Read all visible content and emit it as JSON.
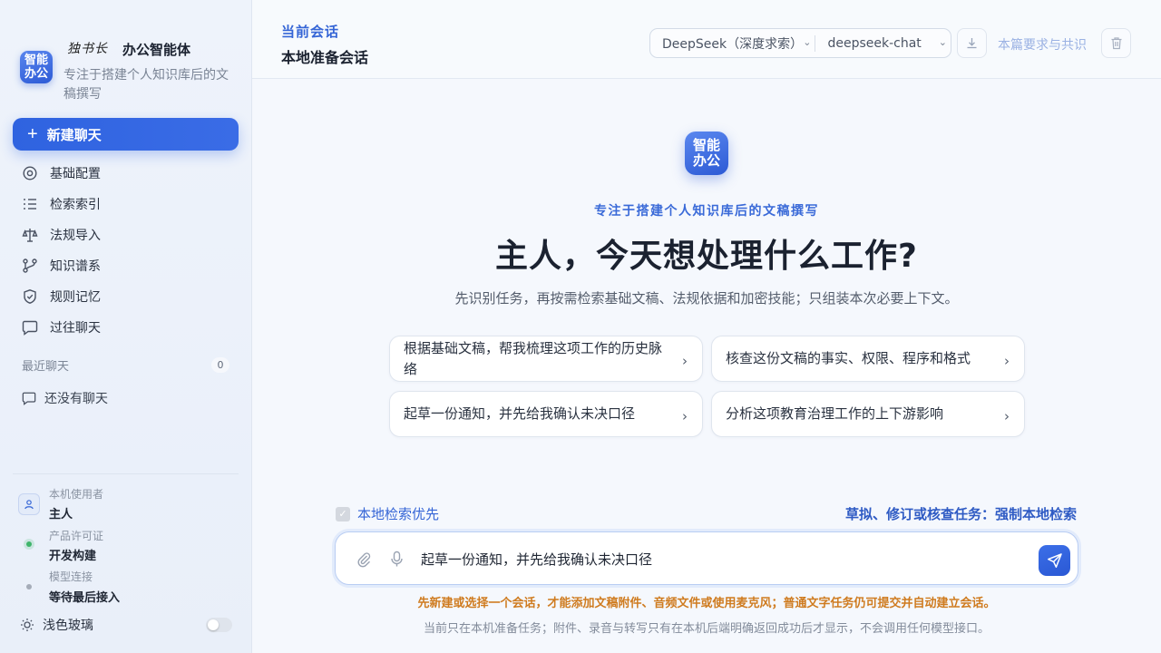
{
  "brand": {
    "logo_text": "智能\n办公",
    "signature": "独书长",
    "name": "办公智能体",
    "description": "专注于搭建个人知识库后的文稿撰写"
  },
  "sidebar": {
    "new_chat_label": "新建聊天",
    "nav": [
      {
        "label": "基础配置",
        "icon": "gear-icon"
      },
      {
        "label": "检索索引",
        "icon": "list-icon"
      },
      {
        "label": "法规导入",
        "icon": "scale-icon"
      },
      {
        "label": "知识谱系",
        "icon": "branch-icon"
      },
      {
        "label": "规则记忆",
        "icon": "shield-icon"
      },
      {
        "label": "过往聊天",
        "icon": "chat-icon"
      }
    ],
    "recent_label": "最近聊天",
    "recent_count": "0",
    "empty_label": "还没有聊天",
    "user_label": "本机使用者",
    "user_value": "主人",
    "license_label": "产品许可证",
    "license_value": "开发构建",
    "model_label": "模型连接",
    "model_value": "等待最后接入",
    "theme_label": "浅色玻璃",
    "license_dot_color": "#3fb56b",
    "model_dot_color": "#a5acb8"
  },
  "header": {
    "conv_label": "当前会话",
    "conv_title": "本地准备会话",
    "provider": "DeepSeek（深度求索）",
    "model": "deepseek-chat",
    "share_label": "本篇要求与共识"
  },
  "hero": {
    "logo_text": "智能\n办公",
    "subtitle": "专注于搭建个人知识库后的文稿撰写",
    "title": "主人，今天想处理什么工作?",
    "description": "先识别任务，再按需检索基础文稿、法规依据和加密技能；只组装本次必要上下文。"
  },
  "suggestions": [
    "根据基础文稿，帮我梳理这项工作的历史脉络",
    "核查这份文稿的事实、权限、程序和格式",
    "起草一份通知，并先给我确认未决口径",
    "分析这项教育治理工作的上下游影响"
  ],
  "composer": {
    "local_first_label": "本地检索优先",
    "force_local_label": "草拟、修订或核查任务：强制本地检索",
    "input_value": "起草一份通知，并先给我确认未决口径",
    "warning": "先新建或选择一个会话，才能添加文稿附件、音频文件或使用麦克风；普通文字任务仍可提交并自动建立会话。",
    "footnote": "当前只在本机准备任务；附件、录音与转写只有在本机后端明确返回成功后才显示，不会调用任何模型接口。"
  },
  "colors": {
    "accent": "#2f63e0",
    "warning": "#cf7b1f"
  }
}
